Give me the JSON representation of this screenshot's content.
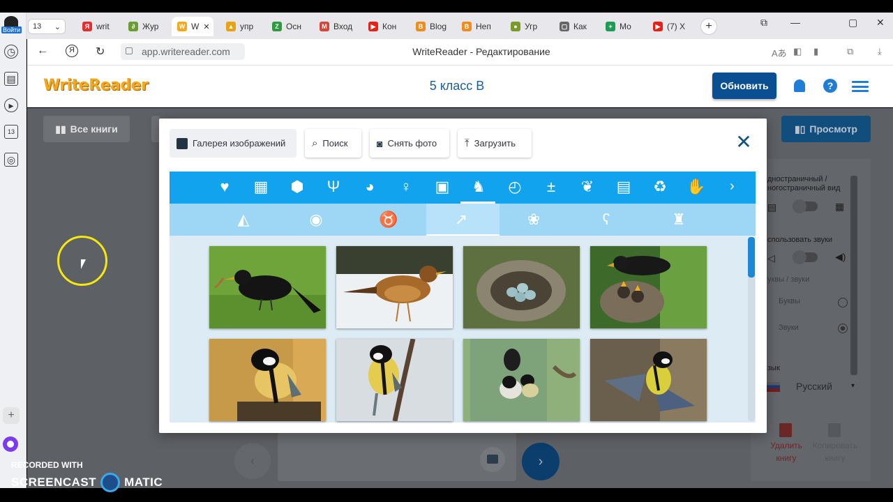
{
  "browser": {
    "tab_counter": "13",
    "login_label": "Войти",
    "tabs": [
      {
        "label": "writ",
        "fav": "Я",
        "color": "#e03030"
      },
      {
        "label": "Жур",
        "fav": "∂",
        "color": "#6a9e35"
      },
      {
        "label": "W",
        "fav": "W",
        "color": "#f4a81d"
      },
      {
        "label": "упр",
        "fav": "▲",
        "color": "#e7a410"
      },
      {
        "label": "Осн",
        "fav": "Z",
        "color": "#2e9b3e"
      },
      {
        "label": "Вход",
        "fav": "M",
        "color": "#d44638"
      },
      {
        "label": "Кон",
        "fav": "▶",
        "color": "#e62117"
      },
      {
        "label": "Blog",
        "fav": "B",
        "color": "#f08c1c"
      },
      {
        "label": "Неп",
        "fav": "B",
        "color": "#f08c1c"
      },
      {
        "label": "Угр",
        "fav": "●",
        "color": "#7a9a2a"
      },
      {
        "label": "Как",
        "fav": "▢",
        "color": "#666666"
      },
      {
        "label": "Мо",
        "fav": "+",
        "color": "#1e9c55"
      },
      {
        "label": "(7) Х",
        "fav": "▶",
        "color": "#e62117"
      }
    ],
    "url": "app.writereader.com",
    "title": "WriteReader - Редактирование"
  },
  "app": {
    "logo": "WriteReader",
    "class_name": "5 класс В",
    "update_label": "Обновить",
    "all_books_label": "Все книги",
    "preview_label": "Просмотр"
  },
  "side_panel": {
    "view_label_1": "дностраничный /",
    "view_label_2": "ногостраничный вид",
    "sounds_label": "спользовать звуки",
    "letters_sounds": "уквы / звуки",
    "letters": "Буквы",
    "sounds": "Звуки",
    "language_label": "зык",
    "language_value": "Русский",
    "delete_label": "Удалить книгу",
    "copy_label": "Копировать книгу"
  },
  "modal": {
    "tabs": {
      "gallery": "Галерея изображений",
      "search": "Поиск",
      "photo": "Снять фото",
      "upload": "Загрузить"
    },
    "categories": [
      "heart-icon",
      "calendar-icon",
      "cube-icon",
      "food-icon",
      "palette-icon",
      "person-icon",
      "chip-icon",
      "animals-icon",
      "clock-icon",
      "math-icon",
      "leaf-icon",
      "id-card-icon",
      "recycle-icon",
      "handshake-icon"
    ],
    "selected_category": "animals-icon",
    "subcategories": [
      "cat-icon",
      "dog-icon",
      "rabbit-icon",
      "bird-icon",
      "paw-icon",
      "bear-icon",
      "dinosaur-icon"
    ],
    "selected_subcategory": "bird-icon",
    "photos": [
      "blackbird",
      "thrush",
      "nest-eggs",
      "blackbird-chicks",
      "great-tit-feeder",
      "great-tit-branch",
      "great-tit-birdhouse",
      "great-tit-flying"
    ]
  },
  "recorder": {
    "line1": "RECORDED WITH",
    "line2a": "SCREENCAST",
    "line2b": "MATIC"
  }
}
